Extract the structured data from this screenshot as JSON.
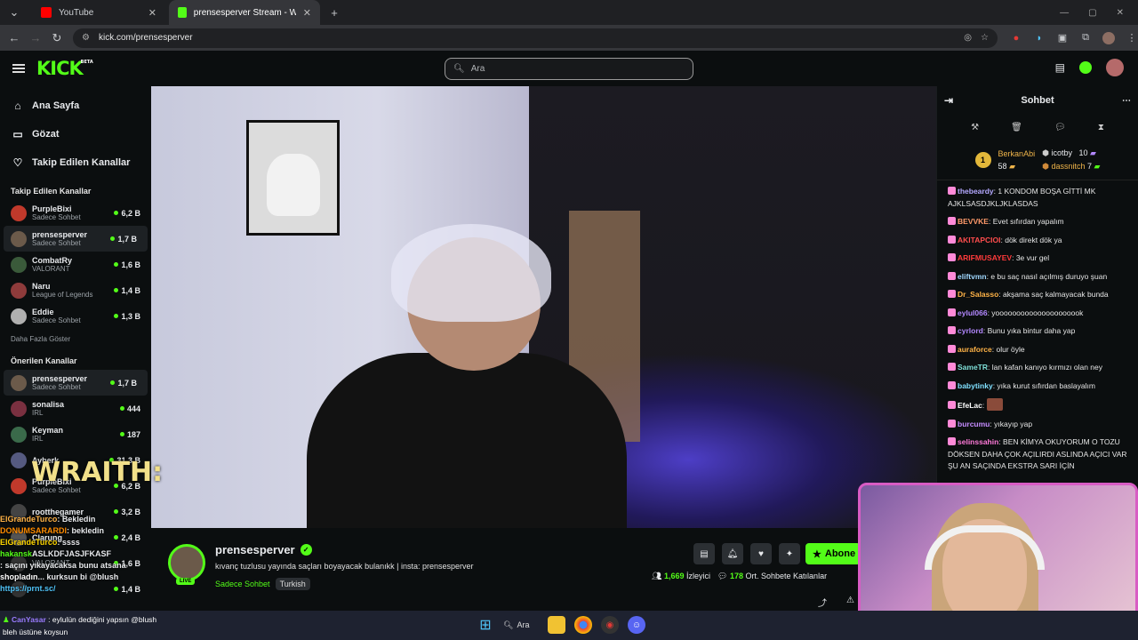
{
  "browser": {
    "tabs": [
      {
        "title": "YouTube",
        "favicon_color": "#ff0000"
      },
      {
        "title": "prensesperver Stream - Watch l",
        "favicon_color": "#53fc18"
      }
    ],
    "url": "kick.com/prensesperver"
  },
  "header": {
    "logo": "KICK",
    "logo_badge": "BETA",
    "search_placeholder": "Ara"
  },
  "sidebar": {
    "nav": [
      {
        "label": "Ana Sayfa",
        "icon": "home-icon"
      },
      {
        "label": "Gözat",
        "icon": "browse-icon"
      },
      {
        "label": "Takip Edilen Kanallar",
        "icon": "heart-icon"
      }
    ],
    "followed_title": "Takip Edilen Kanallar",
    "followed": [
      {
        "name": "PurpleBixi",
        "category": "Sadece Sohbet",
        "viewers": "6,2 B",
        "avatar_color": "#c0392b"
      },
      {
        "name": "prensesperver",
        "category": "Sadece Sohbet",
        "viewers": "1,7 B",
        "avatar_color": "#6b5a4a"
      },
      {
        "name": "CombatRy",
        "category": "VALORANT",
        "viewers": "1,6 B",
        "avatar_color": "#3a5a3a"
      },
      {
        "name": "Naru",
        "category": "League of Legends",
        "viewers": "1,4 B",
        "avatar_color": "#8e3b3b"
      },
      {
        "name": "Eddie",
        "category": "Sadece Sohbet",
        "viewers": "1,3 B",
        "avatar_color": "#b0b0b0"
      }
    ],
    "show_more": "Daha Fazla Göster",
    "recommended_title": "Önerilen Kanallar",
    "recommended": [
      {
        "name": "prensesperver",
        "category": "Sadece Sohbet",
        "viewers": "1,7 B",
        "avatar_color": "#6b5a4a"
      },
      {
        "name": "sonalisa",
        "category": "IRL",
        "viewers": "444",
        "avatar_color": "#7a3040"
      },
      {
        "name": "Keyman",
        "category": "IRL",
        "viewers": "187",
        "avatar_color": "#3a6a4a"
      },
      {
        "name": "Ayberk",
        "category": "",
        "viewers": "31,3 B",
        "avatar_color": "#555a80"
      },
      {
        "name": "PurpleBixi",
        "category": "Sadece Sohbet",
        "viewers": "6,2 B",
        "avatar_color": "#c0392b"
      },
      {
        "name": "rootthegamer",
        "category": "",
        "viewers": "3,2 B",
        "avatar_color": "#444"
      },
      {
        "name": "Clarung",
        "category": "",
        "viewers": "2,4 B",
        "avatar_color": "#555"
      },
      {
        "name": "",
        "category": "VALORANT",
        "viewers": "1,6 B",
        "avatar_color": "#333"
      },
      {
        "name": "",
        "category": "",
        "viewers": "1,4 B",
        "avatar_color": "#333"
      }
    ]
  },
  "stream": {
    "streamer": "prensesperver",
    "live": "LIVE",
    "title": "kıvanç tuzlusu yayında saçları boyayacak bulanıkk | insta: prensesperver",
    "category": "Sadece Sohbet",
    "tag": "Turkish",
    "subscribe_label": "Abone",
    "viewers": "1,669",
    "viewers_label": "İzleyici",
    "avg_chatters": "178",
    "avg_chatters_label": "Ort. Sohbete Katılanlar"
  },
  "chat": {
    "title": "Sohbet",
    "leaderboard": {
      "first": {
        "name": "BerkanAbi",
        "count": "58"
      },
      "second": {
        "name": "icotby",
        "count": "10"
      },
      "third": {
        "name": "dassnitch",
        "count": "7"
      }
    },
    "messages": [
      {
        "user": "thebeardy",
        "color": "#b4a8ff",
        "text": "1 KONDOM BOŞA GİTTİ MK AJKLSASDJKLJKLASDAS"
      },
      {
        "user": "BEVVKE",
        "color": "#ff9a6a",
        "text": "Evet sıfırdan yapalım"
      },
      {
        "user": "AKITAPCIOI",
        "color": "#ff4d4d",
        "text": "dök direkt dök ya"
      },
      {
        "user": "ARIFMUSAYEV",
        "color": "#ff3b3b",
        "text": "3e vur gel"
      },
      {
        "user": "eliftvmn",
        "color": "#a0d8ff",
        "text": "e bu saç nasıl açılmış duruyo şuan"
      },
      {
        "user": "Dr_Salasso",
        "color": "#ffb347",
        "text": "akşama saç kalmayacak bunda"
      },
      {
        "user": "eylul066",
        "color": "#b388ff",
        "text": "yooooooooooooooooooook"
      },
      {
        "user": "cyrlord",
        "color": "#b388ff",
        "text": "Bunu yıka bintur daha yap"
      },
      {
        "user": "auraforce",
        "color": "#ffb347",
        "text": "olur öyle"
      },
      {
        "user": "SameTR",
        "color": "#7fe0d8",
        "text": "lan kafan kanıyo kırmızı olan ney"
      },
      {
        "user": "babytinky",
        "color": "#80e0ff",
        "text": "yıka kurut sıfırdan baslayalım"
      },
      {
        "user": "EfeLac",
        "color": "#ffffff",
        "text": ""
      },
      {
        "user": "burcumu",
        "color": "#c58cff",
        "text": "yıkayıp yap"
      },
      {
        "user": "selinssahin",
        "color": "#ff7ad9",
        "text": "BEN KİMYA OKUYORUM O TOZU DÖKSEN DAHA ÇOK AÇILIRDI ASLINDA AÇICI VAR ŞU AN SAÇINDA EKSTRA SARI İÇİN"
      }
    ]
  },
  "overlay": {
    "wraith_text": "WRAITH:",
    "chat_lines": [
      {
        "user": "ElGrandeTurco",
        "text": ": Bekledin",
        "color": "#ffb347"
      },
      {
        "user": "DONUMSARARDI",
        "text": ": bekledin",
        "color": "#ff8c00"
      },
      {
        "user": "ElGrandeTurco",
        "text": ": ssss",
        "color": "#ffd700"
      },
      {
        "user": "hakansk",
        "text": "ASLKDFJASJFKASF",
        "color": "#53fc18"
      },
      {
        "user": "",
        "text": ": saçını yıkayacaksa bunu atsana",
        "color": "#fff"
      },
      {
        "user": "shopladın",
        "text": "... kurksun bi @blush",
        "color": "#fff"
      },
      {
        "user": "https://prnt.sc/",
        "text": "",
        "color": "#4fc3f7"
      }
    ],
    "bottom_note_user": "CanYasar",
    "bottom_note_line1": ": eylulün dediğini yapsın @blush",
    "bottom_note_line2": "bleh üstüne koysun"
  },
  "taskbar": {
    "search_label": "Ara"
  }
}
